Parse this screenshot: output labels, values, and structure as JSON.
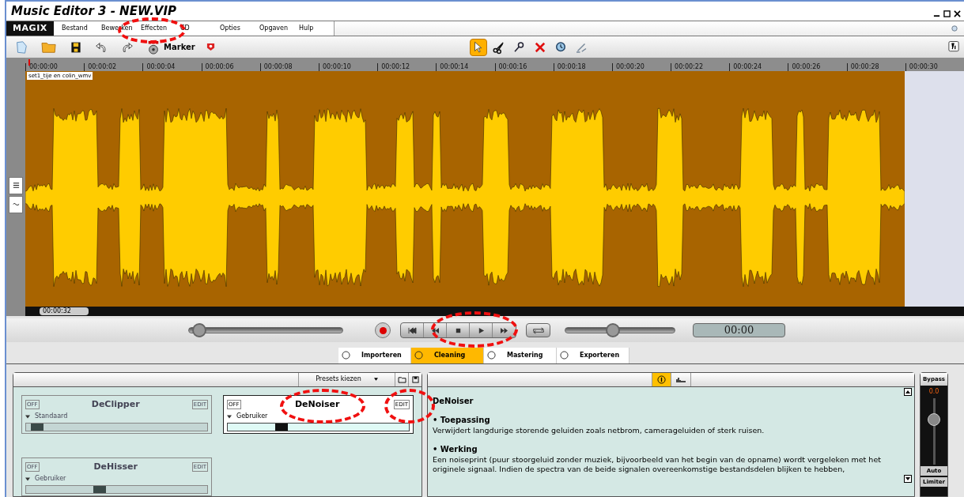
{
  "window": {
    "title": "Music Editor 3 - NEW.VIP"
  },
  "menu": {
    "logo": "MAGIX",
    "items": [
      "Bestand",
      "Bewerken",
      "Effecten",
      "CD",
      "Opties",
      "Opgaven",
      "Hulp"
    ]
  },
  "toolbar": {
    "marker_label": "Marker",
    "tools": [
      {
        "kind": "pointer",
        "selected": true
      },
      {
        "kind": "scissors",
        "selected": false
      },
      {
        "kind": "pin",
        "selected": false
      },
      {
        "kind": "delete",
        "selected": false
      },
      {
        "kind": "zoom",
        "selected": false
      },
      {
        "kind": "pencil",
        "selected": false
      }
    ]
  },
  "ruler": {
    "ticks": [
      "00:00:00",
      "00:00:02",
      "00:00:04",
      "00:00:06",
      "00:00:08",
      "00:00:10",
      "00:00:12",
      "00:00:14",
      "00:00:16",
      "00:00:18",
      "00:00:20",
      "00:00:22",
      "00:00:24",
      "00:00:26",
      "00:00:28",
      "00:00:30"
    ]
  },
  "track": {
    "label": "set1_tije en colin_wmv",
    "length": "00:00:32"
  },
  "transport": {
    "position": {
      "level": 0.02
    },
    "volume": {
      "level": 0.42
    },
    "time": "00:00"
  },
  "tabs": [
    {
      "label": "Importeren",
      "selected": false
    },
    {
      "label": "Cleaning",
      "selected": true
    },
    {
      "label": "Mastering",
      "selected": false
    },
    {
      "label": "Exporteren",
      "selected": false
    }
  ],
  "effects": {
    "presets": "Presets kiezen",
    "modules": [
      {
        "name": "DeClipper",
        "preset": "Standaard",
        "off": "OFF",
        "edit": "EDIT",
        "selected": false,
        "level": 0.03
      },
      {
        "name": "DeNoiser",
        "preset": "Gebruiker",
        "off": "OFF",
        "edit": "EDIT",
        "selected": true,
        "level": 0.28
      },
      {
        "name": "DeHisser",
        "preset": "Gebruiker",
        "off": "OFF",
        "edit": "EDIT",
        "selected": false,
        "level": 0.4
      }
    ]
  },
  "info": {
    "title": "DeNoiser",
    "sections": [
      {
        "heading": "• Toepassing",
        "text": "Verwijdert langdurige storende geluiden zoals netbrom, camerageluiden of sterk ruisen."
      },
      {
        "heading": "• Werking",
        "text": "Een noiseprint (puur stoorgeluid zonder muziek, bijvoorbeeld van het begin van de opname) wordt vergeleken met het originele signaal. Indien de spectra van de beide signalen overeenkomstige bestandsdelen blijken te hebben,"
      }
    ]
  },
  "master": {
    "bypass": "Bypass",
    "value": "0.0",
    "level": 0.72,
    "auto": "Auto",
    "limiter": "Limiter"
  }
}
